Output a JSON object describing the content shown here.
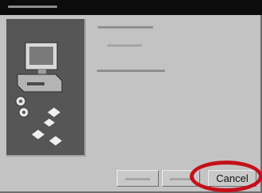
{
  "window": {
    "title": "",
    "text_lines": [
      "",
      "",
      ""
    ]
  },
  "buttons": {
    "back_label": "",
    "next_label": "",
    "cancel_label": "Cancel"
  },
  "icons": {
    "illustration": "computer-setup-icon"
  },
  "colors": {
    "highlight": "#c4101a",
    "title_bar": "#0c0c0c",
    "dialog_bg": "#c3c3c3"
  }
}
